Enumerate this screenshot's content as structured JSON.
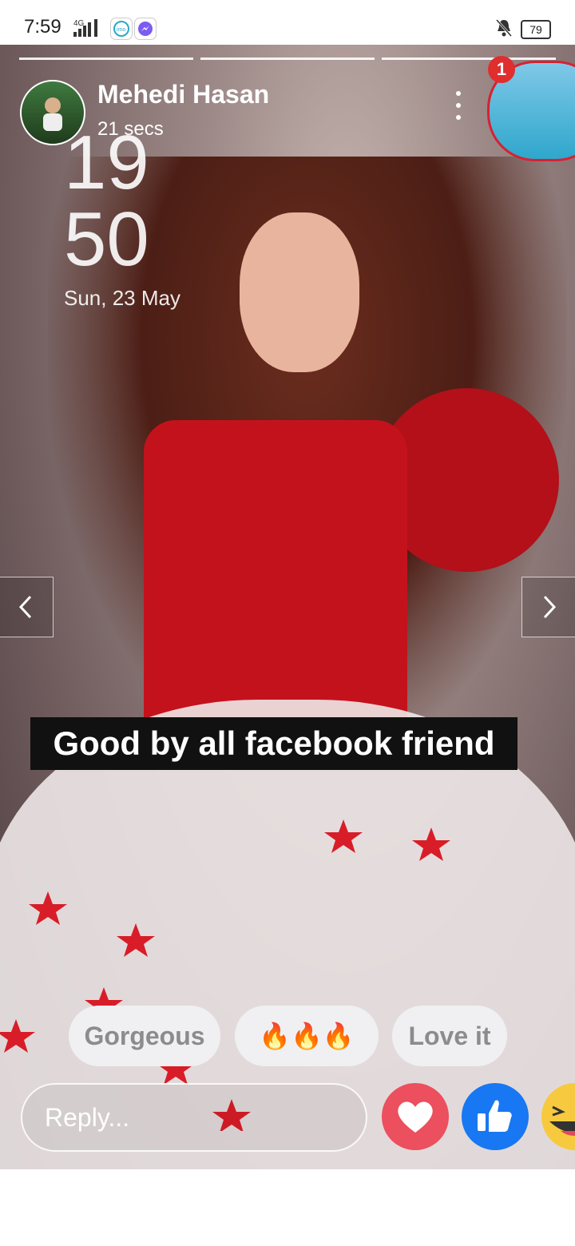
{
  "status_bar": {
    "time": "7:59",
    "network": "4G",
    "battery": "79"
  },
  "story": {
    "author": "Mehedi Hasan",
    "time_ago": "21 secs",
    "next_story_badge": "1",
    "lock_clock": {
      "hour": "19",
      "minute": "50",
      "date": "Sun, 23 May"
    },
    "caption": "Good by all facebook friend",
    "quick_replies": [
      "Gorgeous",
      "🔥🔥🔥",
      "Love it"
    ],
    "reply_placeholder": "Reply..."
  },
  "colors": {
    "love_reaction": "#ec4f5d",
    "like_reaction": "#1877f2",
    "haha_reaction": "#f7c93e",
    "badge": "#e02d2d"
  },
  "icons": {
    "prev": "chevron-left-icon",
    "next": "chevron-right-icon",
    "more": "vertical-ellipsis-icon",
    "love": "heart-icon",
    "like": "thumbs-up-icon",
    "haha": "laughing-face-icon"
  }
}
